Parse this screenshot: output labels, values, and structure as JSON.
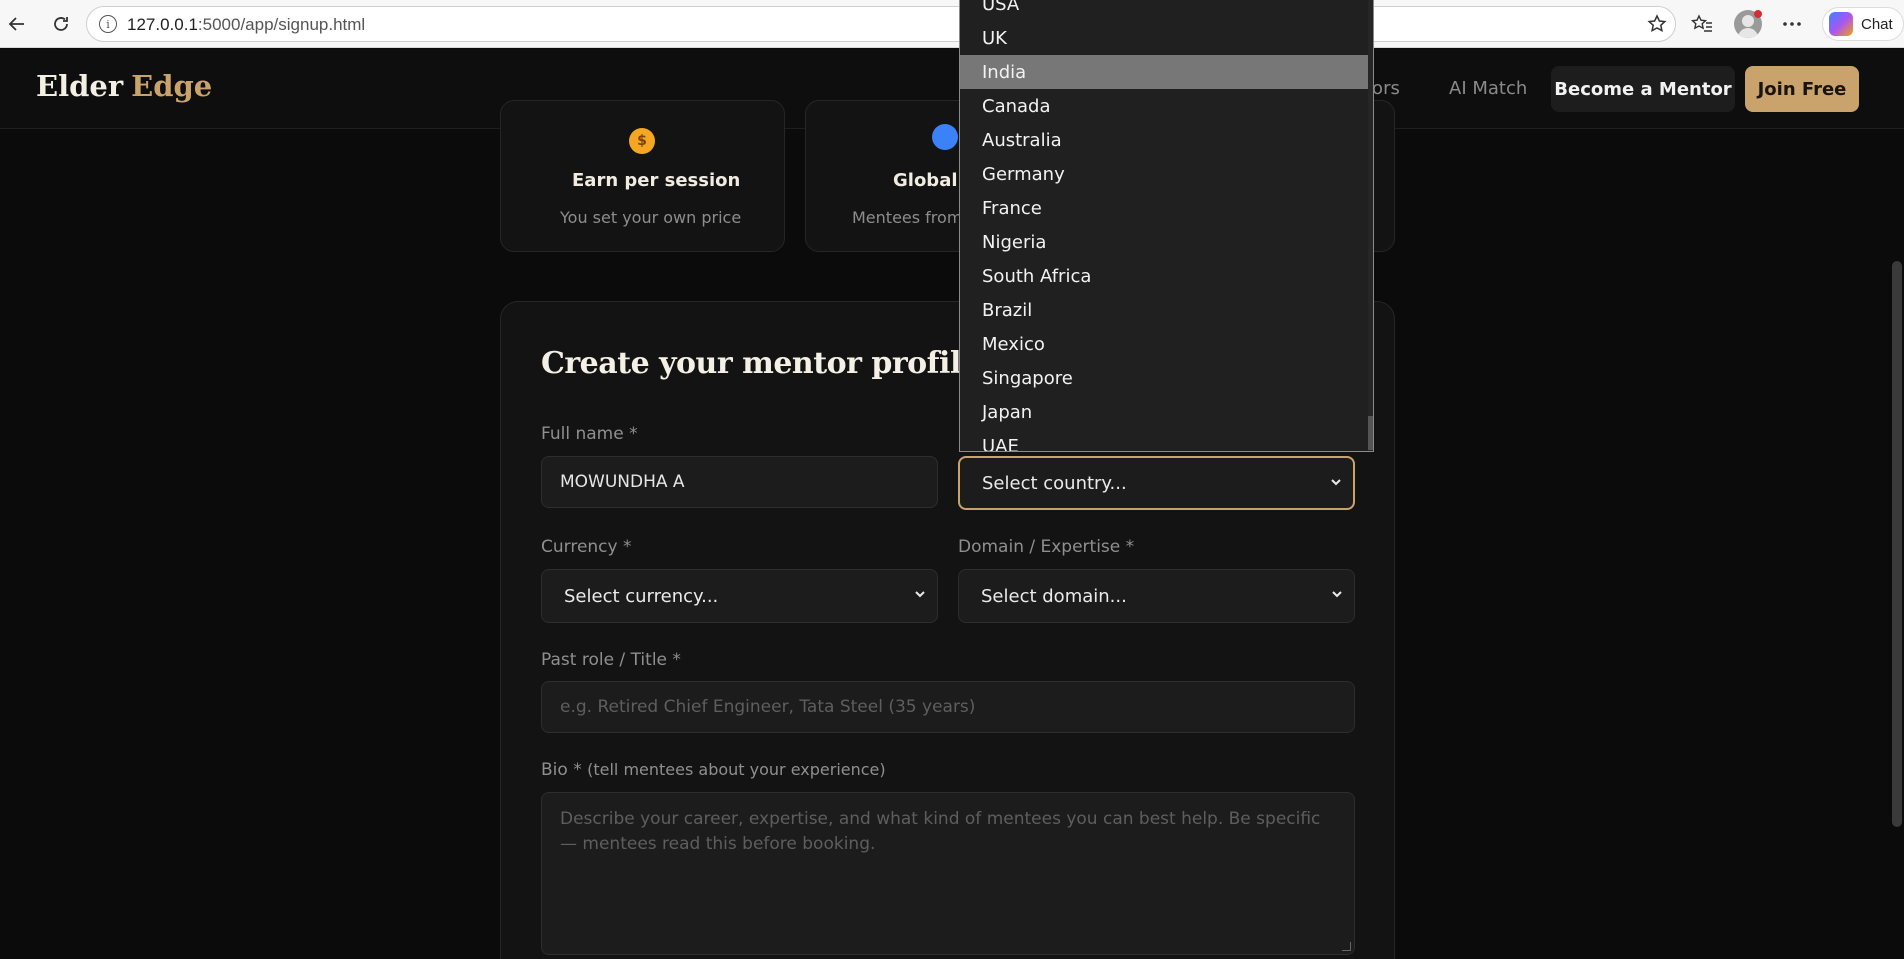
{
  "browser": {
    "url_host": "127.0.0.1",
    "url_rest": ":5000/app/signup.html",
    "chat_label": "Chat"
  },
  "header": {
    "logo_main": "Elder",
    "logo_accent": "Edge",
    "nav_partial": "tors",
    "nav_ai_match": "AI Match",
    "btn_become_mentor": "Become a Mentor",
    "btn_join_free": "Join Free"
  },
  "features": [
    {
      "icon": "$",
      "title": "Earn per session",
      "subtitle": "You set your own price"
    },
    {
      "icon": "",
      "title": "Global r",
      "subtitle": "Mentees from a"
    }
  ],
  "form": {
    "title": "Create your mentor profile",
    "full_name_label": "Full name *",
    "full_name_value": "MOWUNDHA A",
    "country_placeholder": "Select country...",
    "currency_label": "Currency *",
    "currency_placeholder": "Select currency...",
    "domain_label": "Domain / Expertise *",
    "domain_placeholder": "Select domain...",
    "role_label": "Past role / Title *",
    "role_placeholder": "e.g. Retired Chief Engineer, Tata Steel (35 years)",
    "bio_label": "Bio *",
    "bio_hint": "(tell mentees about your experience)",
    "bio_placeholder": "Describe your career, expertise, and what kind of mentees you can best help. Be specific — mentees read this before booking."
  },
  "country_dropdown": {
    "options": [
      "USA",
      "UK",
      "India",
      "Canada",
      "Australia",
      "Germany",
      "France",
      "Nigeria",
      "South Africa",
      "Brazil",
      "Mexico",
      "Singapore",
      "Japan",
      "UAE"
    ],
    "highlighted": "India"
  },
  "colors": {
    "accent": "#c9a36b",
    "background": "#0b0b0b",
    "card": "#131313",
    "input": "#1c1c1c"
  }
}
